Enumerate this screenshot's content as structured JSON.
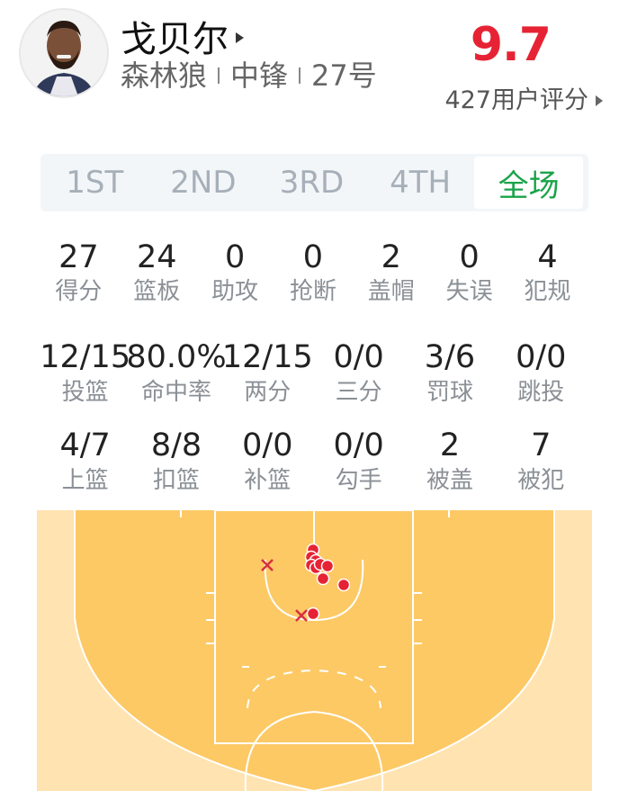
{
  "player": {
    "name": "戈贝尔",
    "team": "森林狼",
    "position": "中锋",
    "number": "27号"
  },
  "rating": {
    "score": "9.7",
    "count_label": "427用户评分"
  },
  "tabs": [
    {
      "label": "1ST",
      "active": false
    },
    {
      "label": "2ND",
      "active": false
    },
    {
      "label": "3RD",
      "active": false
    },
    {
      "label": "4TH",
      "active": false
    },
    {
      "label": "全场",
      "active": true
    }
  ],
  "stats_row1": [
    {
      "value": "27",
      "label": "得分"
    },
    {
      "value": "24",
      "label": "篮板"
    },
    {
      "value": "0",
      "label": "助攻"
    },
    {
      "value": "0",
      "label": "抢断"
    },
    {
      "value": "2",
      "label": "盖帽"
    },
    {
      "value": "0",
      "label": "失误"
    },
    {
      "value": "4",
      "label": "犯规"
    }
  ],
  "stats_row2": [
    {
      "value": "12/15",
      "label": "投篮"
    },
    {
      "value": "80.0%",
      "label": "命中率"
    },
    {
      "value": "12/15",
      "label": "两分"
    },
    {
      "value": "0/0",
      "label": "三分"
    },
    {
      "value": "3/6",
      "label": "罚球"
    },
    {
      "value": "0/0",
      "label": "跳投"
    }
  ],
  "stats_row3": [
    {
      "value": "4/7",
      "label": "上篮"
    },
    {
      "value": "8/8",
      "label": "扣篮"
    },
    {
      "value": "0/0",
      "label": "补篮"
    },
    {
      "value": "0/0",
      "label": "勾手"
    },
    {
      "value": "2",
      "label": "被盖"
    },
    {
      "value": "7",
      "label": "被犯"
    }
  ],
  "colors": {
    "rating": "#e62334",
    "active_tab": "#1aa34a",
    "court_outer": "#ffe3b1",
    "court_inner": "#fdc965",
    "made_shot": "#e62334",
    "missed_shot": "#e62334"
  },
  "shot_chart": {
    "made_count": 12,
    "missed_count": 2
  }
}
